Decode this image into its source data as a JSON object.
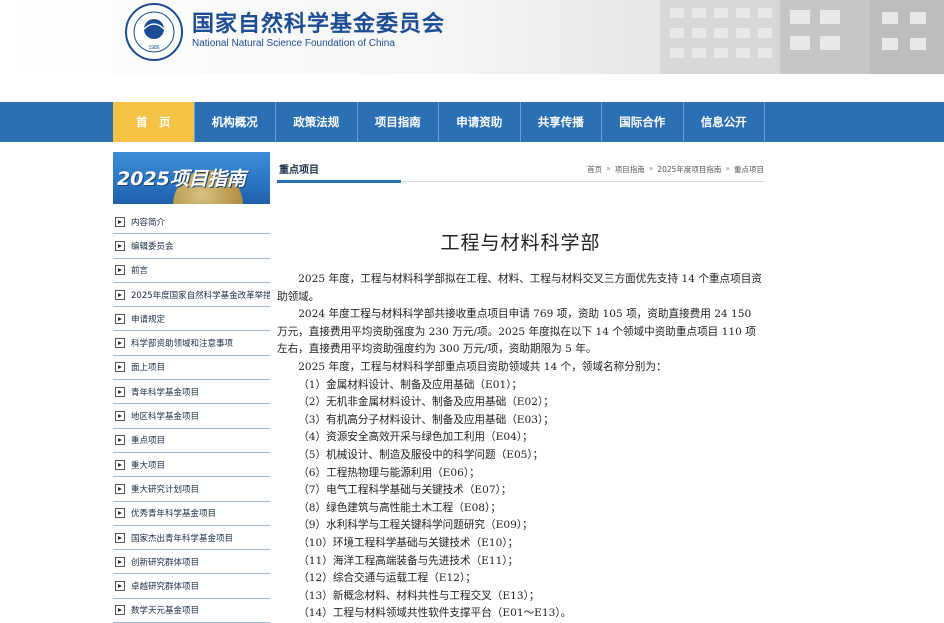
{
  "header": {
    "title_cn": "国家自然科学基金委员会",
    "title_en": "National Natural Science Foundation of China",
    "logo_year": "1986"
  },
  "nav": {
    "items": [
      {
        "label": "首　页",
        "active": true
      },
      {
        "label": "机构概况"
      },
      {
        "label": "政策法规"
      },
      {
        "label": "项目指南"
      },
      {
        "label": "申请资助"
      },
      {
        "label": "共享传播"
      },
      {
        "label": "国际合作"
      },
      {
        "label": "信息公开"
      }
    ]
  },
  "sidebar": {
    "banner": "2025项目指南",
    "items": [
      "内容简介",
      "编辑委员会",
      "前言",
      "2025年度国家自然科学基金改革举措",
      "申请规定",
      "科学部资助领域和注意事项",
      "面上项目",
      "青年科学基金项目",
      "地区科学基金项目",
      "重点项目",
      "重大项目",
      "重大研究计划项目",
      "优秀青年科学基金项目",
      "国家杰出青年科学基金项目",
      "创新研究群体项目",
      "卓越研究群体项目",
      "数学天元基金项目"
    ]
  },
  "content": {
    "section_title": "重点项目",
    "breadcrumb": [
      "首页",
      "项目指南",
      "2025年度项目指南",
      "重点项目"
    ],
    "page_title": "工程与材料科学部",
    "paragraphs": [
      "2025 年度，工程与材料科学部拟在工程、材料、工程与材料交叉三方面优先支持 14 个重点项目资助领域。",
      "2024 年度工程与材料科学部共接收重点项目申请 769 项，资助 105 项，资助直接费用 24 150 万元，直接费用平均资助强度为 230 万元/项。2025 年度拟在以下 14 个领域中资助重点项目 110 项左右，直接费用平均资助强度约为 300 万元/项，资助期限为 5 年。",
      "2025 年度，工程与材料科学部重点项目资助领域共 14 个，领域名称分别为："
    ],
    "fields": [
      "（1）金属材料设计、制备及应用基础（E01）；",
      "（2）无机非金属材料设计、制备及应用基础（E02）；",
      "（3）有机高分子材料设计、制备及应用基础（E03）；",
      "（4）资源安全高效开采与绿色加工利用（E04）；",
      "（5）机械设计、制造及服役中的科学问题（E05）；",
      "（6）工程热物理与能源利用（E06）；",
      "（7）电气工程科学基础与关键技术（E07）；",
      "（8）绿色建筑与高性能土木工程（E08）；",
      "（9）水利科学与工程关键科学问题研究（E09）；",
      "（10）环境工程科学基础与关键技术（E10）；",
      "（11）海洋工程高端装备与先进技术（E11）；",
      "（12）综合交通与运载工程（E12）；",
      "（13）新概念材料、材料共性与工程交叉（E13）；",
      "（14）工程与材料领域共性软件支撑平台（E01～E13）。"
    ]
  },
  "colors": {
    "nav_blue": "#2b6fb4",
    "nav_active": "#f4c245",
    "title_blue": "#1c4c93"
  }
}
